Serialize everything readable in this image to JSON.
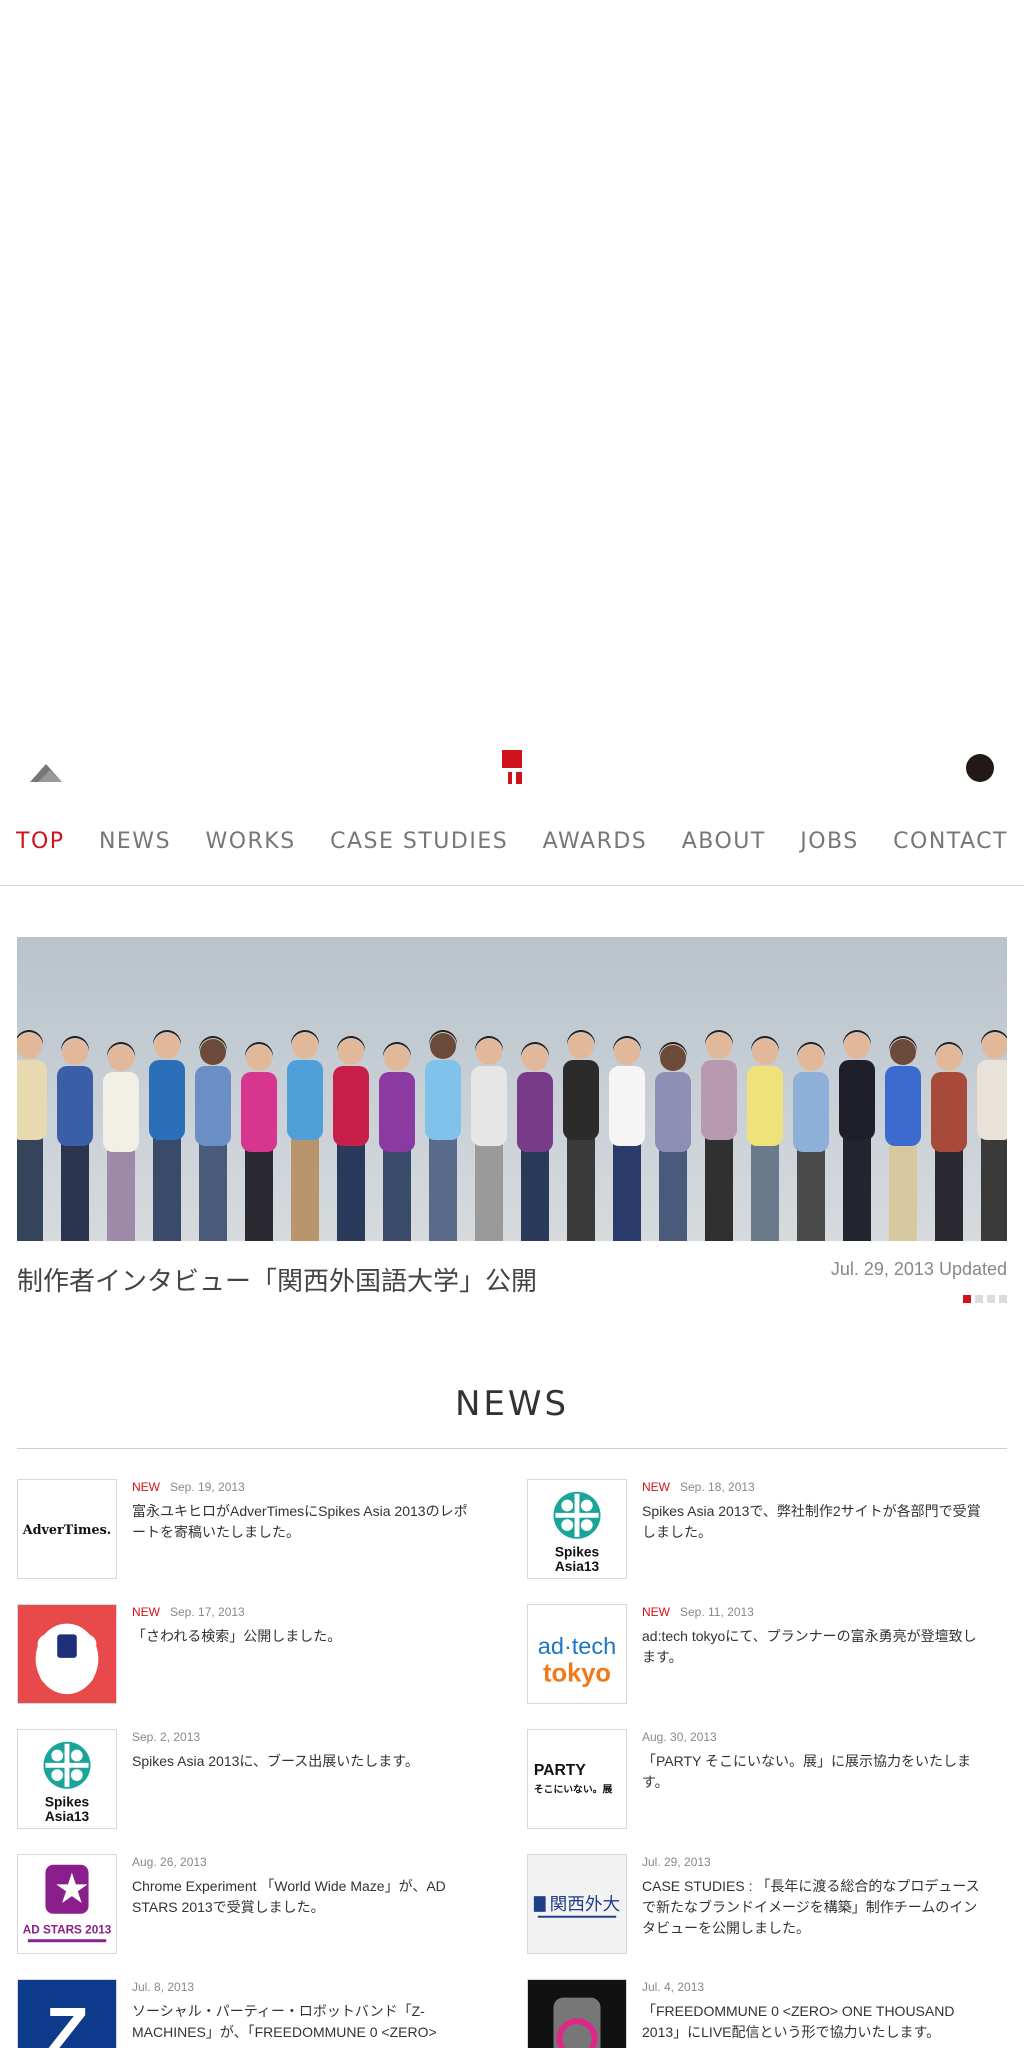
{
  "header": {
    "home_icon": "mountain-icon",
    "logo_icon": "company-logo-mark",
    "menu_icon": "menu-dot-icon",
    "accent_color": "#d0121b"
  },
  "nav": {
    "items": [
      "TOP",
      "NEWS",
      "WORKS",
      "CASE STUDIES",
      "AWARDS",
      "ABOUT",
      "JOBS",
      "CONTACT"
    ],
    "active_index": 0
  },
  "feature": {
    "title": "制作者インタビュー「関西外国語大学」公開",
    "date": "Jul. 29, 2013 Updated",
    "page_count": 4,
    "active_page": 1
  },
  "news": {
    "heading": "NEWS",
    "new_label": "NEW",
    "items": [
      {
        "is_new": true,
        "date": "Sep. 19, 2013",
        "text": "富永ユキヒロがAdverTimesにSpikes Asia 2013のレポートを寄稿いたしました。",
        "thumb": "advertimes-logo",
        "thumb_text": "AdverTimes."
      },
      {
        "is_new": true,
        "date": "Sep. 18, 2013",
        "text": "Spikes Asia 2013で、弊社制作2サイトが各部門で受賞しました。",
        "thumb": "spikes-asia-logo",
        "thumb_text": "Spikes Asia13"
      },
      {
        "is_new": true,
        "date": "Sep. 17, 2013",
        "text": "「さわれる検索」公開しました。",
        "thumb": "sawareru-kensaku-image",
        "thumb_text": ""
      },
      {
        "is_new": true,
        "date": "Sep. 11, 2013",
        "text": "ad:tech tokyoにて、プランナーの富永勇亮が登壇致します。",
        "thumb": "adtech-tokyo-logo",
        "thumb_text": "ad·tech tokyo"
      },
      {
        "is_new": false,
        "date": "Sep. 2, 2013",
        "text": "Spikes Asia 2013に、ブース出展いたします。",
        "thumb": "spikes-asia-logo",
        "thumb_text": "Spikes Asia13"
      },
      {
        "is_new": false,
        "date": "Aug. 30, 2013",
        "text": "「PARTY そこにいない。展」に展示協力をいたします。",
        "thumb": "party-exhibition-logo",
        "thumb_text": "PARTY そこにいない。展"
      },
      {
        "is_new": false,
        "date": "Aug. 26, 2013",
        "text": "Chrome Experiment 「World Wide Maze」が、AD STARS 2013で受賞しました。",
        "thumb": "ad-stars-logo",
        "thumb_text": "AD STARS 2013"
      },
      {
        "is_new": false,
        "date": "Jul. 29, 2013",
        "text": "CASE STUDIES : 「長年に渡る総合的なプロデュースで新たなブランドイメージを構築」制作チームのインタビューを公開しました。",
        "thumb": "kansai-gaidai-logo",
        "thumb_text": "関西外大"
      },
      {
        "is_new": false,
        "date": "Jul. 8, 2013",
        "text": "ソーシャル・パーティー・ロボットバンド「Z-MACHINES」が、「FREEDOMMUNE 0 <ZERO>",
        "thumb": "z-machines-logo",
        "thumb_text": "Z"
      },
      {
        "is_new": false,
        "date": "Jul. 4, 2013",
        "text": "「FREEDOMMUNE 0 <ZERO> ONE THOUSAND 2013」にLIVE配信という形で協力いたします。",
        "thumb": "freedommune-logo",
        "thumb_text": ""
      }
    ]
  }
}
